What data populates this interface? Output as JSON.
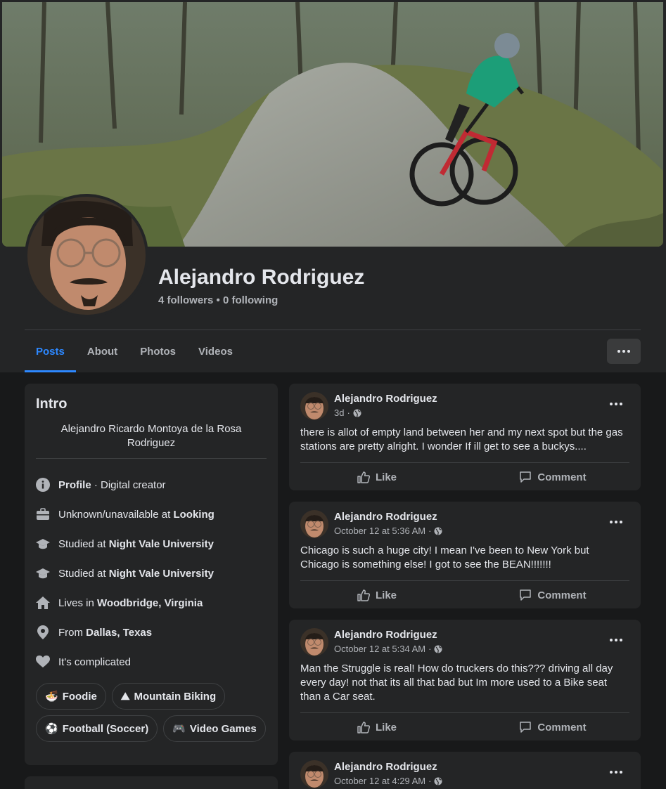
{
  "profile": {
    "name": "Alejandro Rodriguez",
    "stats": "4 followers • 0 following"
  },
  "tabs": [
    {
      "label": "Posts",
      "active": true
    },
    {
      "label": "About"
    },
    {
      "label": "Photos"
    },
    {
      "label": "Videos"
    }
  ],
  "intro": {
    "title": "Intro",
    "bio": "Alejandro Ricardo Montoya de la Rosa Rodriguez",
    "items": [
      {
        "icon": "info-icon",
        "pre": "",
        "bold": "Profile",
        "post": " · Digital creator"
      },
      {
        "icon": "briefcase-icon",
        "pre": "Unknown/unavailable at ",
        "bold": "Looking",
        "post": ""
      },
      {
        "icon": "graduation-cap-icon",
        "pre": "Studied at ",
        "bold": "Night Vale University",
        "post": ""
      },
      {
        "icon": "graduation-cap-icon",
        "pre": "Studied at ",
        "bold": "Night Vale University",
        "post": ""
      },
      {
        "icon": "home-icon",
        "pre": "Lives in ",
        "bold": "Woodbridge, Virginia",
        "post": ""
      },
      {
        "icon": "location-pin-icon",
        "pre": "From ",
        "bold": "Dallas, Texas",
        "post": ""
      },
      {
        "icon": "heart-icon",
        "pre": "It's complicated",
        "bold": "",
        "post": ""
      }
    ],
    "hobbies": [
      {
        "emoji": "🍜",
        "label": "Foodie"
      },
      {
        "emoji": "⛰",
        "label": "Mountain Biking"
      },
      {
        "emoji": "⚽",
        "label": "Football (Soccer)"
      },
      {
        "emoji": "🎮",
        "label": "Video Games"
      }
    ]
  },
  "posts": [
    {
      "author": "Alejandro Rodriguez",
      "time": "3d",
      "text": "there is allot of empty land between her and my next spot but the gas stations are pretty alright. I wonder If ill get to see a buckys...."
    },
    {
      "author": "Alejandro Rodriguez",
      "time": "October 12 at 5:36 AM",
      "text": "Chicago is such a huge city! I mean I've been to New York but Chicago is something else! I got to see the BEAN!!!!!!!"
    },
    {
      "author": "Alejandro Rodriguez",
      "time": "October 12 at 5:34 AM",
      "text": "Man the Struggle is real! How do truckers do this??? driving all day every day! not that its all that bad but Im more used to a Bike seat than a Car seat."
    },
    {
      "author": "Alejandro Rodriguez",
      "time": "October 12 at 4:29 AM",
      "text": ""
    }
  ],
  "actions": {
    "like": "Like",
    "comment": "Comment"
  },
  "colors": {
    "accent": "#2d88ff",
    "card": "#242526",
    "page": "#18191a"
  }
}
